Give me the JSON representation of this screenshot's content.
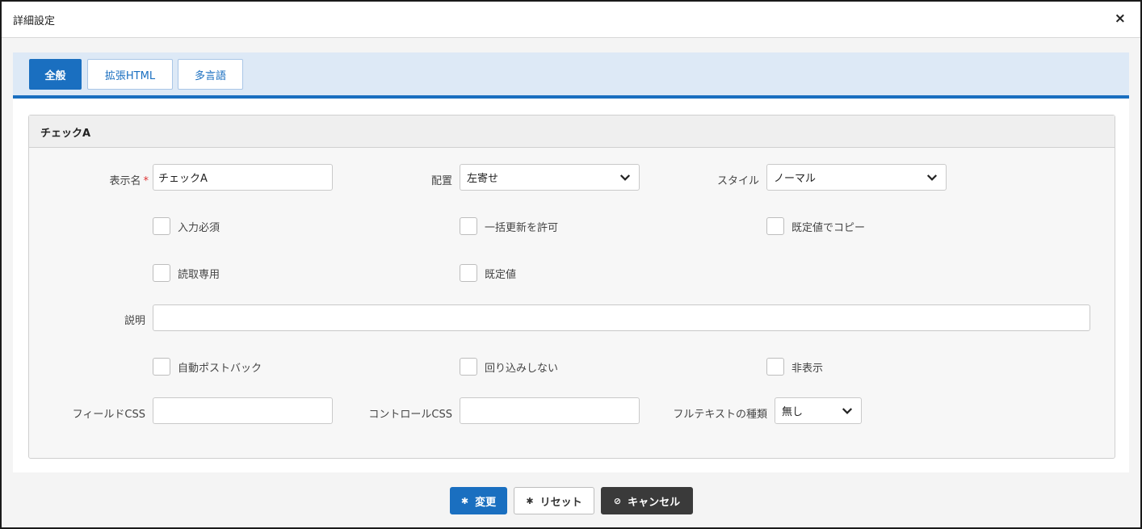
{
  "dialog": {
    "title": "詳細設定",
    "close_icon": "×"
  },
  "tabs": [
    {
      "label": "全般",
      "active": true
    },
    {
      "label": "拡張HTML",
      "active": false
    },
    {
      "label": "多言語",
      "active": false
    }
  ],
  "panel": {
    "title": "チェックA"
  },
  "fields": {
    "display_name": {
      "label": "表示名",
      "required_mark": "*",
      "value": "チェックA"
    },
    "alignment": {
      "label": "配置",
      "selected": "左寄せ"
    },
    "style": {
      "label": "スタイル",
      "selected": "ノーマル"
    },
    "description": {
      "label": "説明",
      "value": ""
    },
    "field_css": {
      "label": "フィールドCSS",
      "value": ""
    },
    "control_css": {
      "label": "コントロールCSS",
      "value": ""
    },
    "fulltext_type": {
      "label": "フルテキストの種類",
      "selected": "無し"
    }
  },
  "checkboxes": {
    "required": {
      "label": "入力必須",
      "checked": false
    },
    "allow_bulk_update": {
      "label": "一括更新を許可",
      "checked": false
    },
    "copy_with_default": {
      "label": "既定値でコピー",
      "checked": false
    },
    "read_only": {
      "label": "読取専用",
      "checked": false
    },
    "default_value": {
      "label": "既定値",
      "checked": false
    },
    "auto_postback": {
      "label": "自動ポストバック",
      "checked": false
    },
    "no_wrap": {
      "label": "回り込みしない",
      "checked": false
    },
    "hidden": {
      "label": "非表示",
      "checked": false
    }
  },
  "footer": {
    "change_label": "変更",
    "reset_label": "リセット",
    "cancel_label": "キャンセル"
  },
  "colors": {
    "accent": "#1a6fc0",
    "tabbar_bg": "#dde9f6",
    "required": "#dd3333",
    "dark_button": "#3a3a3a"
  }
}
